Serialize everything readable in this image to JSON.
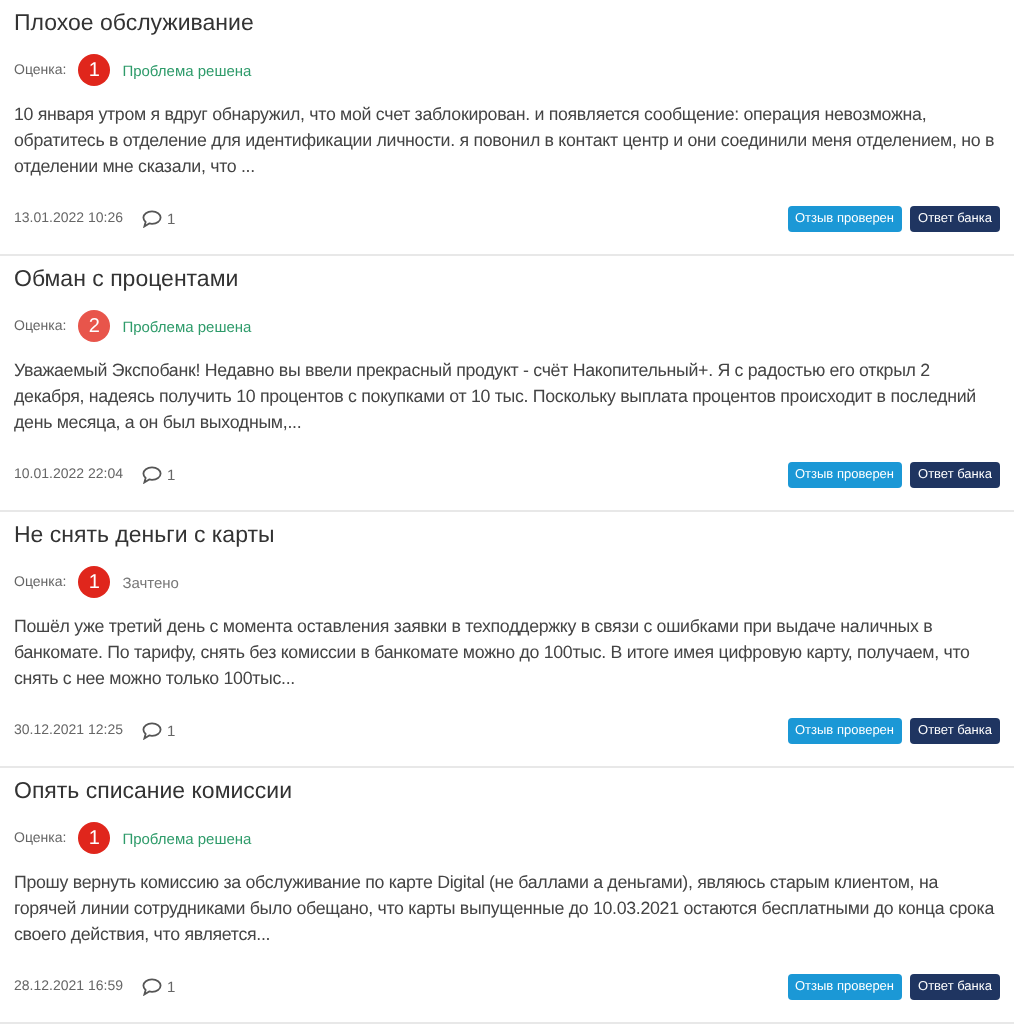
{
  "reviews": [
    {
      "title": "Плохое обслуживание",
      "rating_label": "Оценка:",
      "rating": {
        "value": "1",
        "color": "#e0261c"
      },
      "status": {
        "text": "Проблема решена",
        "color": "#2e9b6a"
      },
      "text": "10 января утром  я вдруг обнаружил, что мой счет заблокирован. и появляется сообщение: операция невозможна, обратитесь в отделение для идентификации личности. я повонил в контакт центр и они соединили меня отделением, но в отделении мне сказали, что ...",
      "date": "13.01.2022 10:26",
      "comments": "1",
      "buttons": [
        {
          "label": "Отзыв проверен",
          "kind": "verified"
        },
        {
          "label": "Ответ банка",
          "kind": "answer"
        }
      ]
    },
    {
      "title": "Обман с процентами",
      "rating_label": "Оценка:",
      "rating": {
        "value": "2",
        "color": "#e8554b"
      },
      "status": {
        "text": "Проблема решена",
        "color": "#2e9b6a"
      },
      "text": "Уважаемый Экспобанк! Недавно вы ввели прекрасный продукт - счёт Накопительный+. Я с радостью его открыл 2 декабря, надеясь получить 10 процентов с покупками от 10 тыс. Поскольку выплата процентов происходит в последний день месяца, а он был выходным,...",
      "date": "10.01.2022 22:04",
      "comments": "1",
      "buttons": [
        {
          "label": "Отзыв проверен",
          "kind": "verified"
        },
        {
          "label": "Ответ банка",
          "kind": "answer"
        }
      ]
    },
    {
      "title": "Не снять деньги с карты",
      "rating_label": "Оценка:",
      "rating": {
        "value": "1",
        "color": "#e0261c"
      },
      "status": {
        "text": "Зачтено",
        "color": "#777777"
      },
      "text": "Пошёл уже третий день с момента оставления заявки в техподдержку в связи с ошибками при выдаче наличных в банкомате. По тарифу, снять без комиссии в банкомате можно до 100тыс. В итоге имея цифровую карту, получаем, что снять с нее можно только 100тыс...",
      "date": "30.12.2021 12:25",
      "comments": "1",
      "buttons": [
        {
          "label": "Отзыв проверен",
          "kind": "verified"
        },
        {
          "label": "Ответ банка",
          "kind": "answer"
        }
      ]
    },
    {
      "title": "Опять списание комиссии",
      "rating_label": "Оценка:",
      "rating": {
        "value": "1",
        "color": "#e0261c"
      },
      "status": {
        "text": "Проблема решена",
        "color": "#2e9b6a"
      },
      "text": "Прошу вернуть комиссию за обслуживание по карте Digital (не баллами а деньгами), являюсь старым клиентом, на горячей линии сотрудниками было обещано, что карты выпущенные до 10.03.2021 остаются бесплатными до конца срока своего действия, что является...",
      "date": "28.12.2021 16:59",
      "comments": "1",
      "buttons": [
        {
          "label": "Отзыв проверен",
          "kind": "verified"
        },
        {
          "label": "Ответ банка",
          "kind": "answer"
        }
      ]
    }
  ]
}
